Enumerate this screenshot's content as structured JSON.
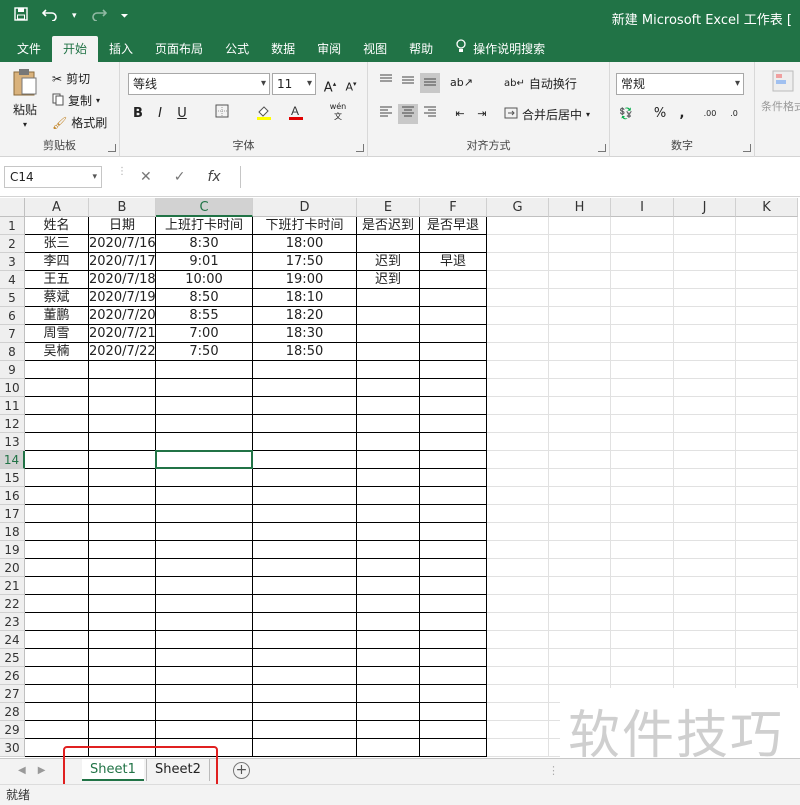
{
  "window": {
    "title": "新建 Microsoft Excel 工作表 [",
    "qat": {
      "save_icon": "save-icon",
      "undo_icon": "undo-icon",
      "redo_icon": "redo-icon",
      "customize_icon": "chevron-down-icon"
    }
  },
  "tabs": [
    {
      "label": "文件"
    },
    {
      "label": "开始",
      "active": true
    },
    {
      "label": "插入"
    },
    {
      "label": "页面布局"
    },
    {
      "label": "公式"
    },
    {
      "label": "数据"
    },
    {
      "label": "审阅"
    },
    {
      "label": "视图"
    },
    {
      "label": "帮助"
    }
  ],
  "tell_me": "操作说明搜索",
  "ribbon": {
    "clipboard": {
      "label": "剪贴板",
      "paste": "粘贴",
      "cut": "剪切",
      "copy": "复制",
      "format_painter": "格式刷"
    },
    "font": {
      "label": "字体",
      "font_name": "等线",
      "font_size": "11",
      "bold": "B",
      "italic": "I",
      "underline": "U",
      "grow": "A",
      "shrink": "A",
      "phonetic": "wén"
    },
    "alignment": {
      "label": "对齐方式",
      "wrap_text": "自动换行",
      "merge_center": "合并后居中"
    },
    "number": {
      "label": "数字",
      "format": "常规",
      "percent": "%",
      "comma": ",",
      "inc_decimal": ".00",
      "dec_decimal": ".0"
    },
    "styles": {
      "conditional_format": "条件格式"
    }
  },
  "formula_bar": {
    "name_box": "C14",
    "fx": "fx",
    "value": ""
  },
  "columns": [
    "A",
    "B",
    "C",
    "D",
    "E",
    "F",
    "G",
    "H",
    "I",
    "J",
    "K"
  ],
  "selected_column": "C",
  "selected_row": 14,
  "rows": [
    {
      "num": "1",
      "cells": [
        "姓名",
        "日期",
        "上班打卡时间",
        "下班打卡时间",
        "是否迟到",
        "是否早退"
      ]
    },
    {
      "num": "2",
      "cells": [
        "张三",
        "2020/7/16",
        "8:30",
        "18:00",
        "",
        ""
      ]
    },
    {
      "num": "3",
      "cells": [
        "李四",
        "2020/7/17",
        "9:01",
        "17:50",
        "迟到",
        "早退"
      ]
    },
    {
      "num": "4",
      "cells": [
        "王五",
        "2020/7/18",
        "10:00",
        "19:00",
        "迟到",
        ""
      ]
    },
    {
      "num": "5",
      "cells": [
        "蔡斌",
        "2020/7/19",
        "8:50",
        "18:10",
        "",
        ""
      ]
    },
    {
      "num": "6",
      "cells": [
        "董鹏",
        "2020/7/20",
        "8:55",
        "18:20",
        "",
        ""
      ]
    },
    {
      "num": "7",
      "cells": [
        "周雪",
        "2020/7/21",
        "7:00",
        "18:30",
        "",
        ""
      ]
    },
    {
      "num": "8",
      "cells": [
        "吴楠",
        "2020/7/22",
        "7:50",
        "18:50",
        "",
        ""
      ]
    },
    {
      "num": "9",
      "cells": [
        "",
        "",
        "",
        "",
        "",
        ""
      ]
    },
    {
      "num": "10",
      "cells": [
        "",
        "",
        "",
        "",
        "",
        ""
      ]
    },
    {
      "num": "11",
      "cells": [
        "",
        "",
        "",
        "",
        "",
        ""
      ]
    },
    {
      "num": "12",
      "cells": [
        "",
        "",
        "",
        "",
        "",
        ""
      ]
    },
    {
      "num": "13",
      "cells": [
        "",
        "",
        "",
        "",
        "",
        ""
      ]
    },
    {
      "num": "14",
      "cells": [
        "",
        "",
        "",
        "",
        "",
        ""
      ]
    },
    {
      "num": "15",
      "cells": [
        "",
        "",
        "",
        "",
        "",
        ""
      ]
    },
    {
      "num": "16",
      "cells": [
        "",
        "",
        "",
        "",
        "",
        ""
      ]
    },
    {
      "num": "17",
      "cells": [
        "",
        "",
        "",
        "",
        "",
        ""
      ]
    },
    {
      "num": "18",
      "cells": [
        "",
        "",
        "",
        "",
        "",
        ""
      ]
    },
    {
      "num": "19",
      "cells": [
        "",
        "",
        "",
        "",
        "",
        ""
      ]
    },
    {
      "num": "20",
      "cells": [
        "",
        "",
        "",
        "",
        "",
        ""
      ]
    },
    {
      "num": "21",
      "cells": [
        "",
        "",
        "",
        "",
        "",
        ""
      ]
    },
    {
      "num": "22",
      "cells": [
        "",
        "",
        "",
        "",
        "",
        ""
      ]
    },
    {
      "num": "23",
      "cells": [
        "",
        "",
        "",
        "",
        "",
        ""
      ]
    },
    {
      "num": "24",
      "cells": [
        "",
        "",
        "",
        "",
        "",
        ""
      ]
    },
    {
      "num": "25",
      "cells": [
        "",
        "",
        "",
        "",
        "",
        ""
      ]
    },
    {
      "num": "26",
      "cells": [
        "",
        "",
        "",
        "",
        "",
        ""
      ]
    },
    {
      "num": "27",
      "cells": [
        "",
        "",
        "",
        "",
        "",
        ""
      ]
    },
    {
      "num": "28",
      "cells": [
        "",
        "",
        "",
        "",
        "",
        ""
      ]
    },
    {
      "num": "29",
      "cells": [
        "",
        "",
        "",
        "",
        "",
        ""
      ]
    },
    {
      "num": "30",
      "cells": [
        "",
        "",
        "",
        "",
        "",
        ""
      ]
    }
  ],
  "sheets": [
    {
      "name": "Sheet1",
      "active": true
    },
    {
      "name": "Sheet2",
      "active": false
    }
  ],
  "status": "就绪",
  "watermark": "软件技巧",
  "colors": {
    "brand": "#217346",
    "annotation": "#e02020"
  }
}
